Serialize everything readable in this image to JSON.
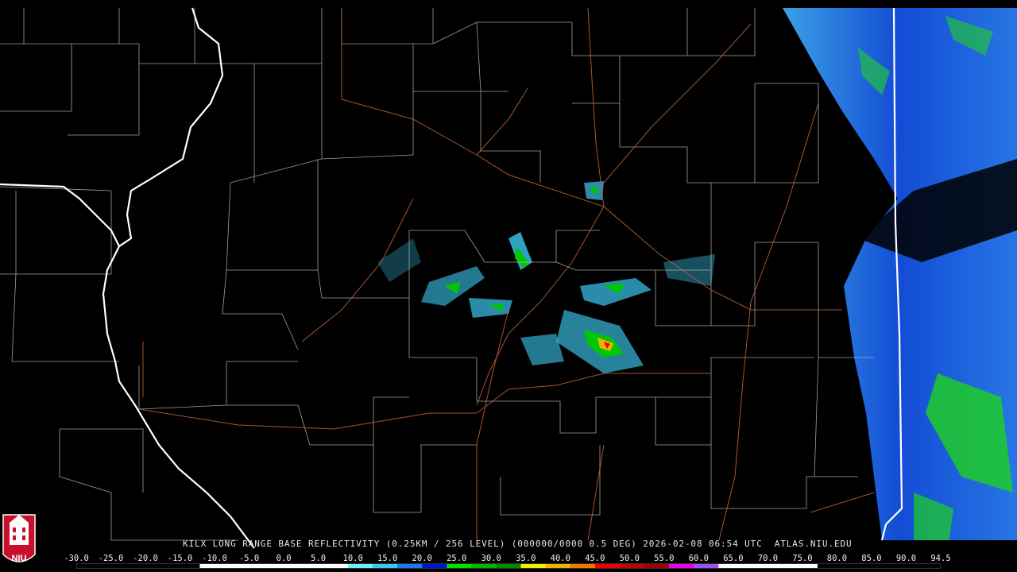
{
  "product_caption": "KILX LONG RANGE BASE REFLECTIVITY (0.25KM / 256 LEVEL) (000000/0000 0.5 DEG) 2026-02-08 06:54 UTC  ATLAS.NIU.EDU",
  "color_scale": {
    "labels": [
      "-30.0",
      "-25.0",
      "-20.0",
      "-15.0",
      "-10.0",
      "-5.0",
      "0.0",
      "5.0",
      "10.0",
      "15.0",
      "20.0",
      "25.0",
      "30.0",
      "35.0",
      "40.0",
      "45.0",
      "50.0",
      "55.0",
      "60.0",
      "65.0",
      "70.0",
      "75.0",
      "80.0",
      "85.0",
      "90.0",
      "94.5"
    ],
    "colors": [
      "#ffffff",
      "#ffffff",
      "#ffffff",
      "#ffffff",
      "#ffffff",
      "#ffffff",
      "#6ef0f0",
      "#3cc8f0",
      "#1e78f0",
      "#0014d8",
      "#00e000",
      "#00b400",
      "#008c00",
      "#f0f000",
      "#f0b400",
      "#f07800",
      "#f00000",
      "#c80000",
      "#a00000",
      "#f000f0",
      "#a050f0",
      "#ffffff",
      "#ffffff",
      "#ffffff",
      "#ffffff"
    ]
  },
  "logo": {
    "text": "NIU",
    "color": "#c8102e"
  }
}
